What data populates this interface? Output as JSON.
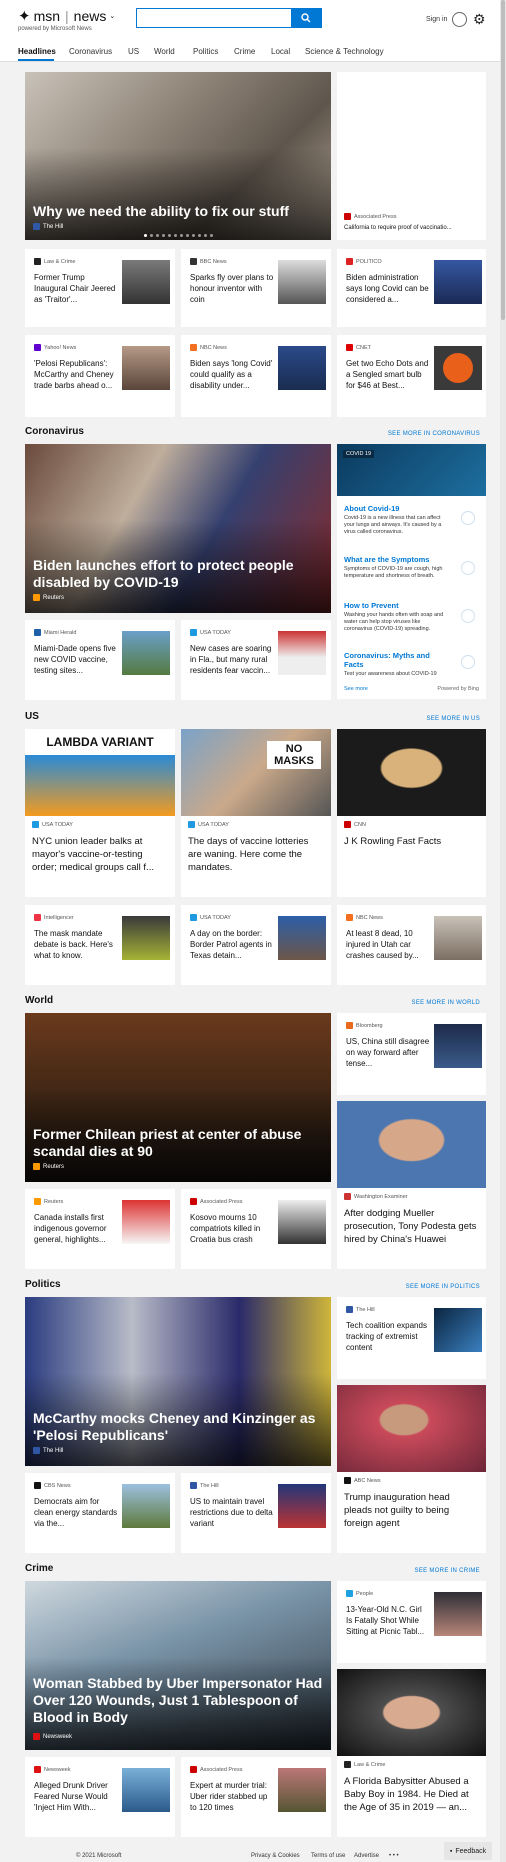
{
  "header": {
    "brand": "msn",
    "section": "news",
    "powered": "powered by Microsoft News",
    "search_placeholder": "",
    "signin": "Sign in"
  },
  "nav": [
    "Headlines",
    "Coronavirus",
    "US",
    "World",
    "Politics",
    "Crime",
    "Local",
    "Science & Technology"
  ],
  "headlines": {
    "hero": {
      "title": "Why we need the ability to fix our stuff",
      "source": "The Hill"
    },
    "side": {
      "title": "California to require proof of vaccinatio...",
      "source": "Associated Press"
    },
    "row1": [
      {
        "source": "Law & Crime",
        "title": "Former Trump Inaugural Chair Jeered as 'Traitor'..."
      },
      {
        "source": "BBC News",
        "title": "Sparks fly over plans to honour inventor with coin"
      },
      {
        "source": "POLITICO",
        "title": "Biden administration says long Covid can be considered a..."
      }
    ],
    "row2": [
      {
        "source": "Yahoo! News",
        "title": "'Pelosi Republicans': McCarthy and Cheney trade barbs ahead o..."
      },
      {
        "source": "NBC News",
        "title": "Biden says 'long Covid' could qualify as a disability under..."
      },
      {
        "source": "CNET",
        "title": "Get two Echo Dots and a Sengled smart bulb for $46 at Best..."
      }
    ]
  },
  "coronavirus": {
    "label": "Coronavirus",
    "more": "SEE MORE IN CORONAVIRUS",
    "hero": {
      "title": "Biden launches effort to protect people disabled by COVID-19",
      "source": "Reuters"
    },
    "row": [
      {
        "source": "Miami Herald",
        "title": "Miami-Dade opens five new COVID vaccine, testing sites..."
      },
      {
        "source": "USA TODAY",
        "title": "New cases are soaring in Fla., but many rural residents fear vaccin..."
      }
    ],
    "panel": {
      "tag": "COVID 19",
      "items": [
        {
          "title": "About Covid-19",
          "text": "Covid-19 is a new illness that can affect your lungs and airways. It's caused by a virus called coronavirus."
        },
        {
          "title": "What are the Symptoms",
          "text": "Symptoms of COVID-19 are cough, high temperature and shortness of breath."
        },
        {
          "title": "How to Prevent",
          "text": "Washing your hands often with soap and water can help stop viruses like coronavirus (COVID-19) spreading."
        },
        {
          "title": "Coronavirus: Myths and Facts",
          "text": "Test your awareness about COVID-19"
        }
      ],
      "see_more": "See more",
      "powered": "Powered by Bing"
    }
  },
  "us": {
    "label": "US",
    "more": "SEE MORE IN US",
    "tiles": [
      {
        "source": "USA TODAY",
        "title": "NYC union leader balks at mayor's vaccine-or-testing order; medical groups call f...",
        "img_text": "LAMBDA VARIANT"
      },
      {
        "source": "USA TODAY",
        "title": "The days of vaccine lotteries are waning. Here come the mandates.",
        "img_text": "NO MASKS"
      },
      {
        "source": "CNN",
        "title": "J K Rowling Fast Facts"
      }
    ],
    "row": [
      {
        "source": "Intelligencer",
        "title": "The mask mandate debate is back. Here's what to know."
      },
      {
        "source": "USA TODAY",
        "title": "A day on the border: Border Patrol agents in Texas detain..."
      },
      {
        "source": "NBC News",
        "title": "At least 8 dead, 10 injured in Utah car crashes caused by..."
      }
    ]
  },
  "world": {
    "label": "World",
    "more": "SEE MORE IN WORLD",
    "hero": {
      "title": "Former Chilean priest at center of abuse scandal dies at 90",
      "source": "Reuters"
    },
    "side": {
      "source": "Bloomberg",
      "title": "US, China still disagree on way forward after tense..."
    },
    "tile": {
      "source": "Washington Examiner",
      "title": "After dodging Mueller prosecution, Tony Podesta gets hired by China's Huawei"
    },
    "row": [
      {
        "source": "Reuters",
        "title": "Canada installs first indigenous governor general, highlights..."
      },
      {
        "source": "Associated Press",
        "title": "Kosovo mourns 10 compatriots killed in Croatia bus crash"
      }
    ]
  },
  "politics": {
    "label": "Politics",
    "more": "SEE MORE IN POLITICS",
    "hero": {
      "title": "McCarthy mocks Cheney and Kinzinger as 'Pelosi Republicans'",
      "source": "The Hill"
    },
    "side": {
      "source": "The Hill",
      "title": "Tech coalition expands tracking of extremist content"
    },
    "tile": {
      "source": "ABC News",
      "title": "Trump inauguration head pleads not guilty to being foreign agent"
    },
    "row": [
      {
        "source": "CBS News",
        "title": "Democrats aim for clean energy standards via the..."
      },
      {
        "source": "The Hill",
        "title": "US to maintain travel restrictions due to delta variant"
      }
    ]
  },
  "crime": {
    "label": "Crime",
    "more": "SEE MORE IN CRIME",
    "hero": {
      "title": "Woman Stabbed by Uber Impersonator Had Over 120 Wounds, Just 1 Tablespoon of Blood in Body",
      "source": "Newsweek"
    },
    "side": {
      "source": "People",
      "title": "13-Year-Old N.C. Girl Is Fatally Shot While Sitting at Picnic Tabl..."
    },
    "tile": {
      "source": "Law & Crime",
      "title": "A Florida Babysitter Abused a Baby Boy in 1984. He Died at the Age of 35 in 2019 — an..."
    },
    "row": [
      {
        "source": "Newsweek",
        "title": "Alleged Drunk Driver Feared Nurse Would 'Inject Him With..."
      },
      {
        "source": "Associated Press",
        "title": "Expert at murder trial: Uber rider stabbed up to 120 times"
      }
    ]
  },
  "footer": {
    "copyright": "© 2021 Microsoft",
    "privacy": "Privacy & Cookies",
    "terms": "Terms of use",
    "advertise": "Advertise",
    "ellipsis": "• • •",
    "feedback": "Feedback"
  }
}
